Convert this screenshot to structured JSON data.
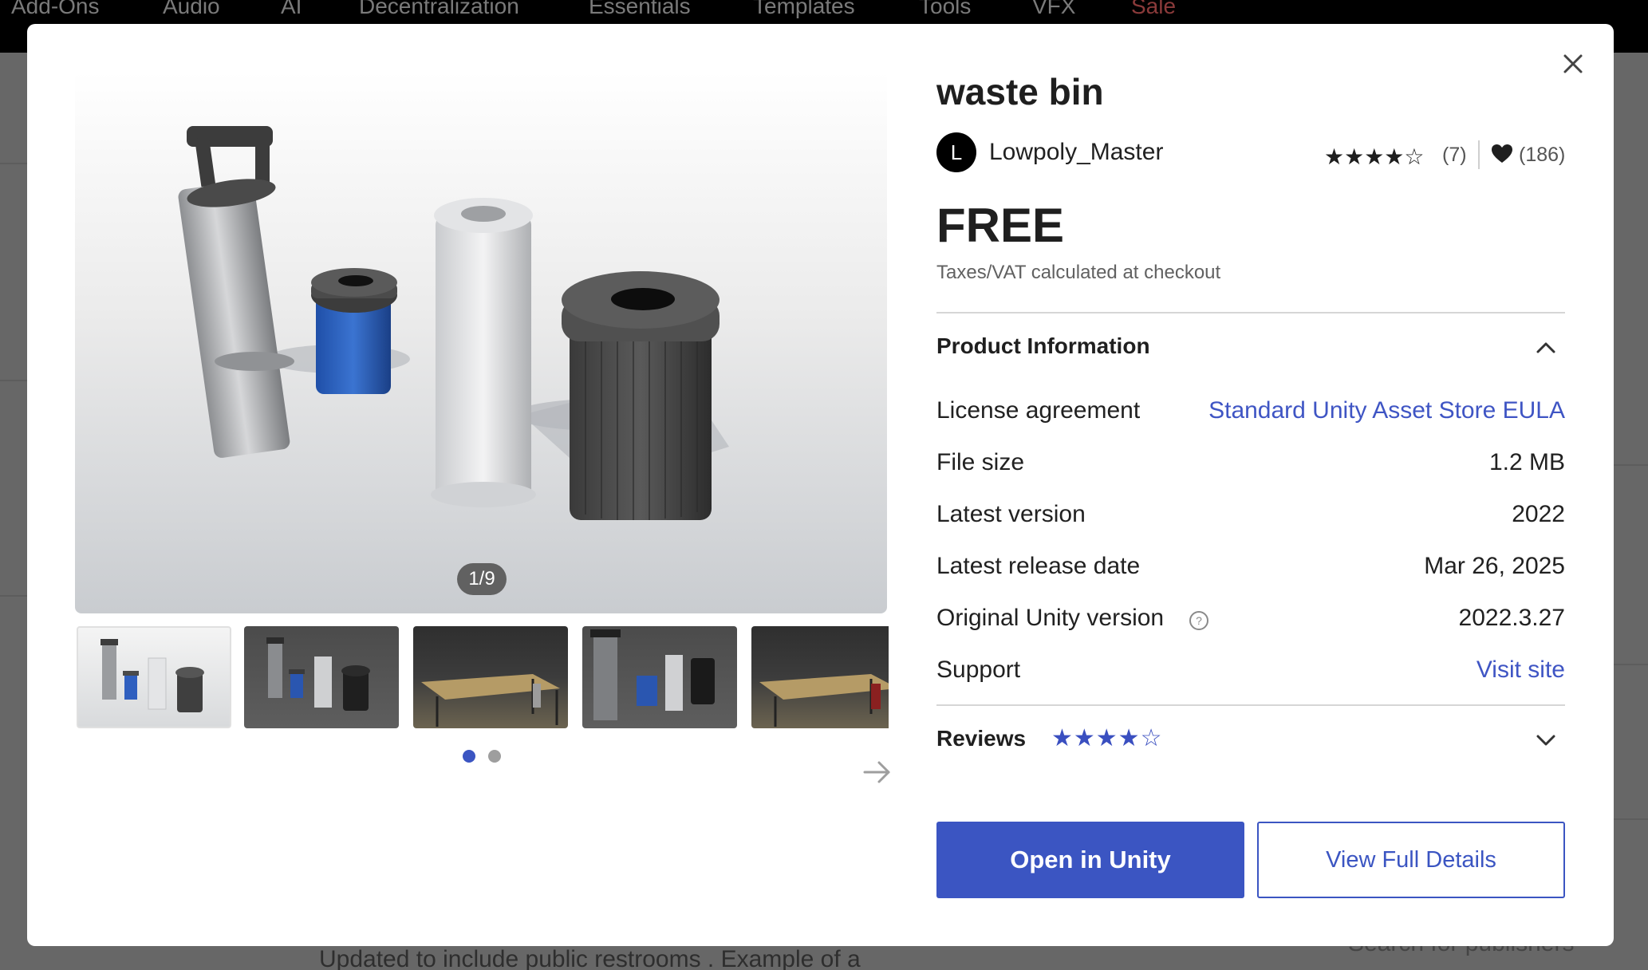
{
  "background": {
    "nav_items": [
      "Add-Ons",
      "Audio",
      "AI",
      "Decentralization",
      "Essentials",
      "Templates",
      "Tools",
      "VFX",
      "Sale"
    ],
    "bottom_text": "Updated to include public restrooms . Example of a",
    "search_hint": "Search for publishers"
  },
  "modal": {
    "title": "waste bin",
    "publisher": {
      "avatar_letter": "L",
      "name": "Lowpoly_Master"
    },
    "rating": {
      "stars": 4,
      "count": "(7)"
    },
    "favorites": {
      "count": "(186)"
    },
    "price": "FREE",
    "tax_note": "Taxes/VAT calculated at checkout",
    "gallery": {
      "counter": "1/9",
      "current_page": 1,
      "page_count": 2,
      "thumbnail_count": 5
    },
    "product_info": {
      "heading": "Product Information",
      "rows": [
        {
          "label": "License agreement",
          "value": "Standard Unity Asset Store EULA",
          "link": true
        },
        {
          "label": "File size",
          "value": "1.2 MB"
        },
        {
          "label": "Latest version",
          "value": "2022"
        },
        {
          "label": "Latest release date",
          "value": "Mar 26, 2025"
        },
        {
          "label": "Original Unity version",
          "value": "2022.3.27"
        },
        {
          "label": "Support",
          "value": "Visit site",
          "link": true
        }
      ]
    },
    "reviews": {
      "heading": "Reviews",
      "stars": 4
    },
    "buttons": {
      "open_in_unity": "Open in Unity",
      "view_full_details": "View Full Details"
    },
    "colors": {
      "accent": "#3b55c2",
      "link": "#3f55c4"
    }
  }
}
